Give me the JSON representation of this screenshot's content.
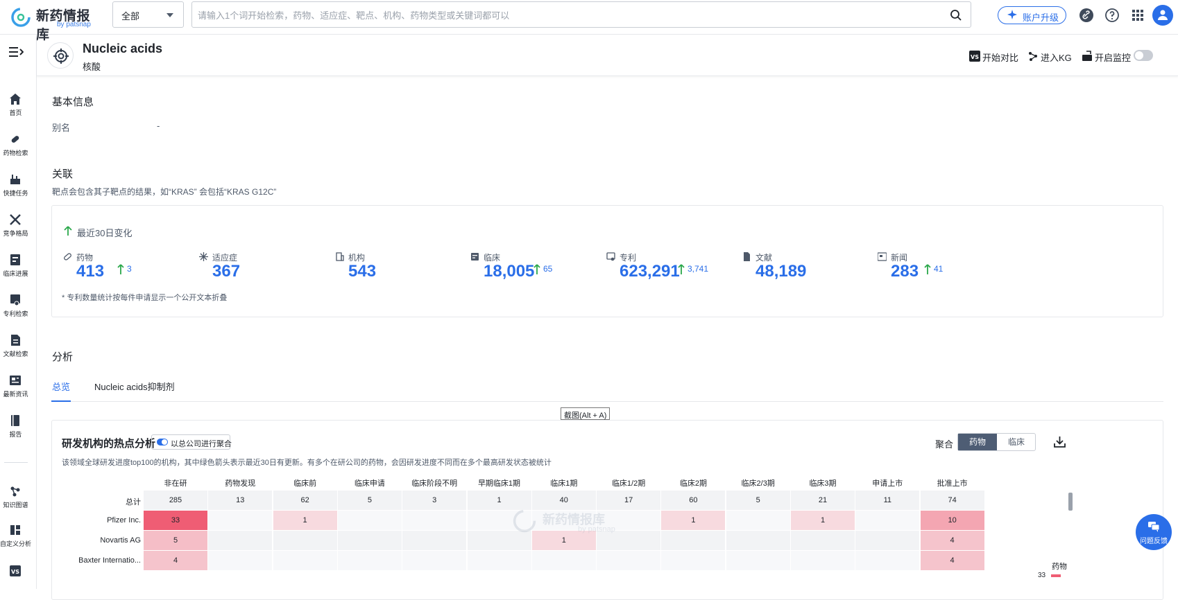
{
  "app": {
    "logo_text": "新药情报库",
    "logo_by": "by patsnap",
    "scope_value": "全部",
    "search_placeholder": "请输入1个词开始检索，药物、适应症、靶点、机构、药物类型或关键词都可以",
    "upgrade_label": "账户升级"
  },
  "sidebar": {
    "items": [
      {
        "label": "首页",
        "icon": "home-icon"
      },
      {
        "label": "药物检索",
        "icon": "pill-icon"
      },
      {
        "label": "快捷任务",
        "icon": "task-icon"
      },
      {
        "label": "竞争格局",
        "icon": "swords-icon"
      },
      {
        "label": "临床进展",
        "icon": "clinical-icon"
      },
      {
        "label": "专利检索",
        "icon": "patent-icon"
      },
      {
        "label": "文献检索",
        "icon": "document-icon"
      },
      {
        "label": "最新资讯",
        "icon": "news-icon"
      },
      {
        "label": "报告",
        "icon": "report-icon"
      },
      {
        "label": "知识图谱",
        "icon": "graph-icon"
      },
      {
        "label": "自定义分析",
        "icon": "dashboard-icon"
      },
      {
        "label": "",
        "icon": "vs-icon"
      }
    ]
  },
  "header": {
    "title_en": "Nucleic acids",
    "title_cn": "核酸",
    "compare_label": "开始对比",
    "kg_label": "进入KG",
    "monitor_label": "开启监控",
    "vs_badge": "VS"
  },
  "basic": {
    "section_title": "基本信息",
    "alias_label": "别名",
    "alias_value": "-"
  },
  "related": {
    "section_title": "关联",
    "note": "靶点会包含其子靶点的结果，如“KRAS” 会包括“KRAS G12C”",
    "change_title": "最近30日变化",
    "foot_note": "* 专利数量统计按每件申请显示一个公开文本折叠",
    "stats": [
      {
        "label": "药物",
        "value": "413",
        "delta": "3",
        "icon": "pill-icon"
      },
      {
        "label": "适应症",
        "value": "367",
        "delta": "",
        "icon": "snowflake-icon"
      },
      {
        "label": "机构",
        "value": "543",
        "delta": "",
        "icon": "building-icon"
      },
      {
        "label": "临床",
        "value": "18,005",
        "delta": "65",
        "icon": "clinical-icon"
      },
      {
        "label": "专利",
        "value": "623,291",
        "delta": "3,741",
        "icon": "patent-icon"
      },
      {
        "label": "文献",
        "value": "48,189",
        "delta": "",
        "icon": "document-icon"
      },
      {
        "label": "新闻",
        "value": "283",
        "delta": "41",
        "icon": "news-icon"
      }
    ]
  },
  "analysis": {
    "section_title": "分析",
    "tabs": [
      "总览",
      "Nucleic acids抑制剂"
    ],
    "tooltip": "截图(Alt + A)",
    "card_title": "研发机构的热点分析",
    "agg_toggle_label": "以总公司进行聚合",
    "description": "该领域全球研发进度top100的机构，其中绿色箭头表示最近30日有更新。有多个在研公司的药物，会因研发进度不同而在多个最高研发状态被统计",
    "agg_label": "聚合",
    "seg_options": [
      "药物",
      "临床"
    ],
    "columns": [
      "非在研",
      "药物发现",
      "临床前",
      "临床申请",
      "临床阶段不明",
      "早期临床1期",
      "临床1期",
      "临床1/2期",
      "临床2期",
      "临床2/3期",
      "临床3期",
      "申请上市",
      "批准上市"
    ],
    "rows": [
      {
        "name": "总计",
        "values": [
          "285",
          "13",
          "62",
          "5",
          "3",
          "1",
          "40",
          "17",
          "60",
          "5",
          "21",
          "11",
          "74"
        ]
      },
      {
        "name": "Pfizer Inc.",
        "values": [
          "33",
          "",
          "1",
          "",
          "",
          "",
          "",
          "",
          "1",
          "",
          "1",
          "",
          "10"
        ]
      },
      {
        "name": "Novartis AG",
        "values": [
          "5",
          "",
          "",
          "",
          "",
          "",
          "1",
          "",
          "",
          "",
          "",
          "",
          "4"
        ]
      },
      {
        "name": "Baxter Internatio...",
        "values": [
          "4",
          "",
          "",
          "",
          "",
          "",
          "",
          "",
          "",
          "",
          "",
          "",
          "4"
        ]
      }
    ],
    "legend_label": "药物",
    "legend_max": "33",
    "watermark_text": "新药情报库",
    "watermark_by": "by patsnap",
    "feedback_label": "问题反馈"
  },
  "colors": {
    "accent": "#2a6ee8",
    "green": "#2aa84a",
    "heat_max": "#ef5d74"
  }
}
